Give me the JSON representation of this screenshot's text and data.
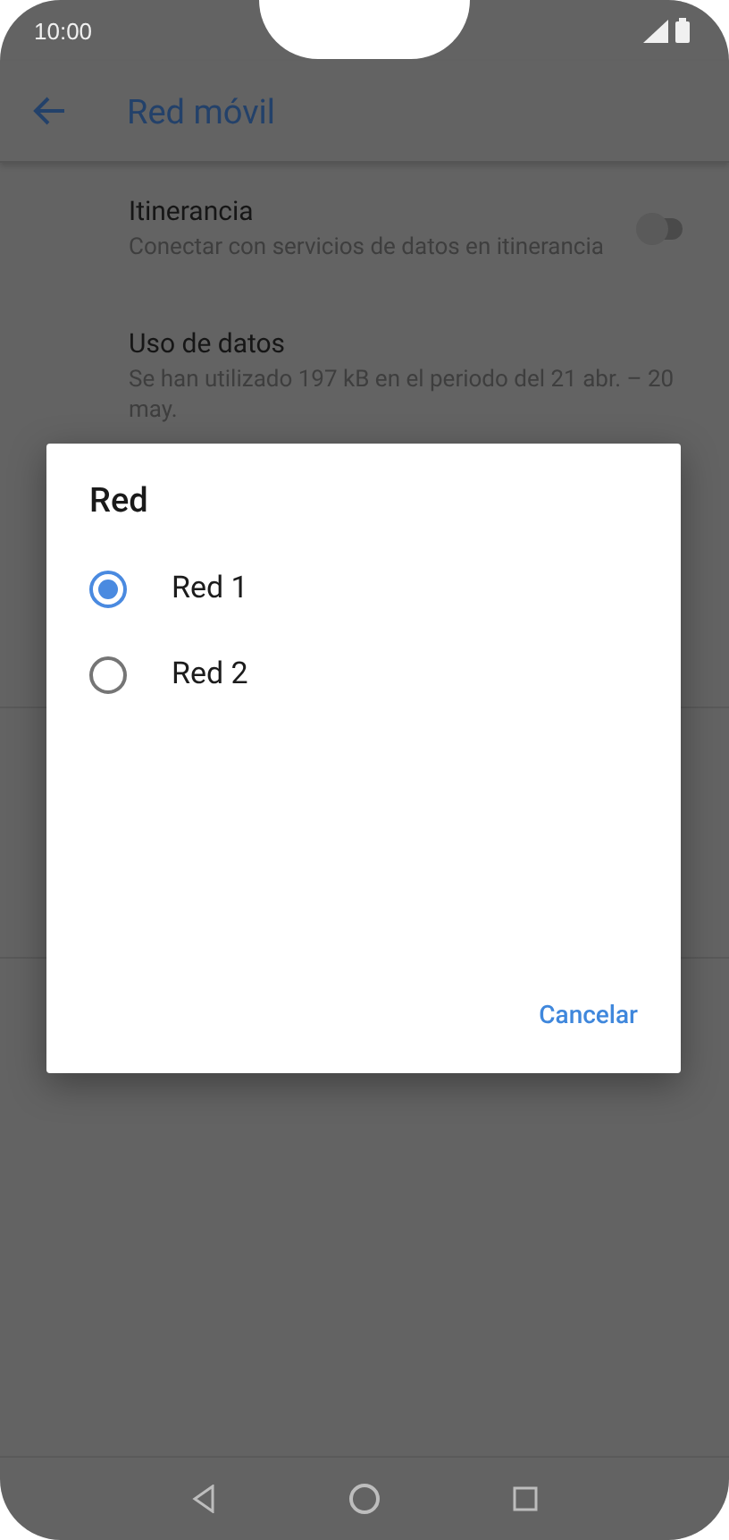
{
  "status_bar": {
    "time": "10:00"
  },
  "app_bar": {
    "title": "Red móvil"
  },
  "settings": [
    {
      "kind": "toggle",
      "title": "Itinerancia",
      "description": "Conectar con servicios de datos en itinerancia",
      "on": false
    },
    {
      "kind": "text",
      "title": "Uso de datos",
      "description": "Se han utilizado 197 kB en el periodo del 21 abr. – 20 may."
    }
  ],
  "dialog": {
    "title": "Red",
    "options": [
      {
        "label": "Red 1",
        "selected": true
      },
      {
        "label": "Red 2",
        "selected": false
      }
    ],
    "buttons": [
      "Cancelar"
    ]
  }
}
